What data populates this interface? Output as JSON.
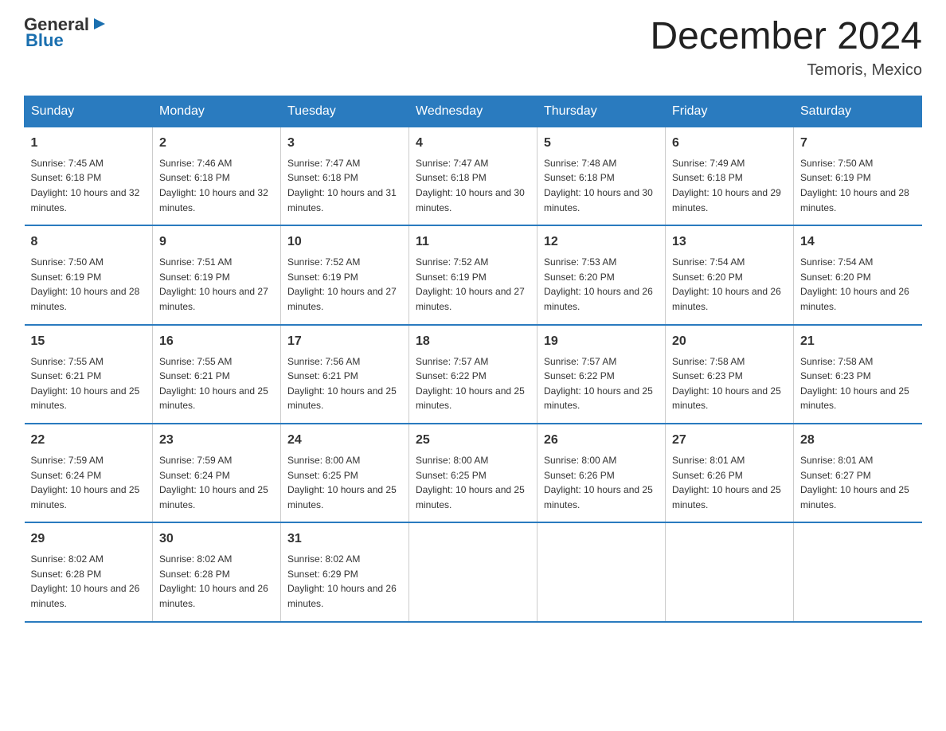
{
  "header": {
    "logo_text_general": "General",
    "logo_text_blue": "Blue",
    "month_title": "December 2024",
    "location": "Temoris, Mexico"
  },
  "days_of_week": [
    "Sunday",
    "Monday",
    "Tuesday",
    "Wednesday",
    "Thursday",
    "Friday",
    "Saturday"
  ],
  "weeks": [
    [
      {
        "day": "1",
        "sunrise": "7:45 AM",
        "sunset": "6:18 PM",
        "daylight": "10 hours and 32 minutes."
      },
      {
        "day": "2",
        "sunrise": "7:46 AM",
        "sunset": "6:18 PM",
        "daylight": "10 hours and 32 minutes."
      },
      {
        "day": "3",
        "sunrise": "7:47 AM",
        "sunset": "6:18 PM",
        "daylight": "10 hours and 31 minutes."
      },
      {
        "day": "4",
        "sunrise": "7:47 AM",
        "sunset": "6:18 PM",
        "daylight": "10 hours and 30 minutes."
      },
      {
        "day": "5",
        "sunrise": "7:48 AM",
        "sunset": "6:18 PM",
        "daylight": "10 hours and 30 minutes."
      },
      {
        "day": "6",
        "sunrise": "7:49 AM",
        "sunset": "6:18 PM",
        "daylight": "10 hours and 29 minutes."
      },
      {
        "day": "7",
        "sunrise": "7:50 AM",
        "sunset": "6:19 PM",
        "daylight": "10 hours and 28 minutes."
      }
    ],
    [
      {
        "day": "8",
        "sunrise": "7:50 AM",
        "sunset": "6:19 PM",
        "daylight": "10 hours and 28 minutes."
      },
      {
        "day": "9",
        "sunrise": "7:51 AM",
        "sunset": "6:19 PM",
        "daylight": "10 hours and 27 minutes."
      },
      {
        "day": "10",
        "sunrise": "7:52 AM",
        "sunset": "6:19 PM",
        "daylight": "10 hours and 27 minutes."
      },
      {
        "day": "11",
        "sunrise": "7:52 AM",
        "sunset": "6:19 PM",
        "daylight": "10 hours and 27 minutes."
      },
      {
        "day": "12",
        "sunrise": "7:53 AM",
        "sunset": "6:20 PM",
        "daylight": "10 hours and 26 minutes."
      },
      {
        "day": "13",
        "sunrise": "7:54 AM",
        "sunset": "6:20 PM",
        "daylight": "10 hours and 26 minutes."
      },
      {
        "day": "14",
        "sunrise": "7:54 AM",
        "sunset": "6:20 PM",
        "daylight": "10 hours and 26 minutes."
      }
    ],
    [
      {
        "day": "15",
        "sunrise": "7:55 AM",
        "sunset": "6:21 PM",
        "daylight": "10 hours and 25 minutes."
      },
      {
        "day": "16",
        "sunrise": "7:55 AM",
        "sunset": "6:21 PM",
        "daylight": "10 hours and 25 minutes."
      },
      {
        "day": "17",
        "sunrise": "7:56 AM",
        "sunset": "6:21 PM",
        "daylight": "10 hours and 25 minutes."
      },
      {
        "day": "18",
        "sunrise": "7:57 AM",
        "sunset": "6:22 PM",
        "daylight": "10 hours and 25 minutes."
      },
      {
        "day": "19",
        "sunrise": "7:57 AM",
        "sunset": "6:22 PM",
        "daylight": "10 hours and 25 minutes."
      },
      {
        "day": "20",
        "sunrise": "7:58 AM",
        "sunset": "6:23 PM",
        "daylight": "10 hours and 25 minutes."
      },
      {
        "day": "21",
        "sunrise": "7:58 AM",
        "sunset": "6:23 PM",
        "daylight": "10 hours and 25 minutes."
      }
    ],
    [
      {
        "day": "22",
        "sunrise": "7:59 AM",
        "sunset": "6:24 PM",
        "daylight": "10 hours and 25 minutes."
      },
      {
        "day": "23",
        "sunrise": "7:59 AM",
        "sunset": "6:24 PM",
        "daylight": "10 hours and 25 minutes."
      },
      {
        "day": "24",
        "sunrise": "8:00 AM",
        "sunset": "6:25 PM",
        "daylight": "10 hours and 25 minutes."
      },
      {
        "day": "25",
        "sunrise": "8:00 AM",
        "sunset": "6:25 PM",
        "daylight": "10 hours and 25 minutes."
      },
      {
        "day": "26",
        "sunrise": "8:00 AM",
        "sunset": "6:26 PM",
        "daylight": "10 hours and 25 minutes."
      },
      {
        "day": "27",
        "sunrise": "8:01 AM",
        "sunset": "6:26 PM",
        "daylight": "10 hours and 25 minutes."
      },
      {
        "day": "28",
        "sunrise": "8:01 AM",
        "sunset": "6:27 PM",
        "daylight": "10 hours and 25 minutes."
      }
    ],
    [
      {
        "day": "29",
        "sunrise": "8:02 AM",
        "sunset": "6:28 PM",
        "daylight": "10 hours and 26 minutes."
      },
      {
        "day": "30",
        "sunrise": "8:02 AM",
        "sunset": "6:28 PM",
        "daylight": "10 hours and 26 minutes."
      },
      {
        "day": "31",
        "sunrise": "8:02 AM",
        "sunset": "6:29 PM",
        "daylight": "10 hours and 26 minutes."
      },
      null,
      null,
      null,
      null
    ]
  ],
  "labels": {
    "sunrise_prefix": "Sunrise: ",
    "sunset_prefix": "Sunset: ",
    "daylight_prefix": "Daylight: "
  }
}
